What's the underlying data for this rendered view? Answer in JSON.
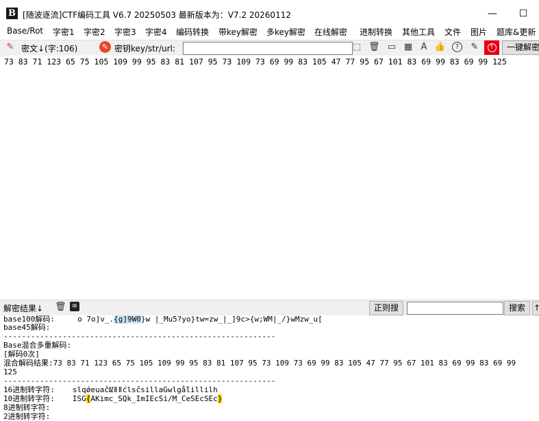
{
  "window": {
    "logo_text": "B",
    "title": "[随波逐流]CTF编码工具 V6.7 20250503     最新版本为：V7.2  20260112",
    "minimize": "—",
    "maximize": "☐"
  },
  "menu": {
    "items": [
      "Base/Rot",
      "字密1",
      "字密2",
      "字密3",
      "字密4",
      "编码转换",
      "带key解密",
      "多key解密",
      "在线解密",
      "进制转换",
      "其他工具",
      "文件",
      "图片",
      "题库&更新"
    ]
  },
  "toolbar": {
    "cipher_label": "密文↓(字:106)",
    "key_label": "密钥key/str/url:",
    "key_value": "",
    "oneclick_label": "一键解密"
  },
  "cipher": {
    "text": "73 83 71 123 65 75 105 109 99 95 83 81 107 95 73 109 73 69 99 83 105 47 77 95 67 101 83 69 99 83 69 99 125"
  },
  "result_bar": {
    "label": "解密结果↓",
    "regex_button": "正则搜",
    "search_value": "",
    "search_button": "搜索",
    "up_arrow": "↑"
  },
  "result": {
    "line_base100_prefix": "base100解码:     o 7o]v_.",
    "line_base100_hl": "{g]9W0",
    "line_base100_suffix": "}w |_Mu5?yo}tw=zw_|_]9c>{w;WM|_/}wMzw_u[",
    "line_base45": "base45解码:",
    "divider1": "------------------------------------------------------------",
    "line_mixed_title": "Base混合多重解码:",
    "line_mixed_count": "[解码0次]",
    "line_mixed_result": "混合解码结果:73 83 71 123 65 75 105 109 99 95 83 81 107 95 73 109 73 69 99 83 105 47 77 95 67 101 83 69 99 83 69 99",
    "line_mixed_result_cont": "125",
    "divider2": "------------------------------------------------------------",
    "line_hex_label": "16进制转字符:",
    "line_hex_value": "slqǿeuačǱǁǁćlsčsillaGwlgǻlillilh",
    "line_dec_label": "10进制转字符:",
    "line_dec_prefix": "ISG",
    "line_dec_hl1": "{",
    "line_dec_mid": "AKimc_SQk_ImIEcSi/M_CeSEcSEc",
    "line_dec_hl2": "}",
    "line_oct_label": "8进制转字符:",
    "line_bin_label": "2进制转字符:"
  }
}
